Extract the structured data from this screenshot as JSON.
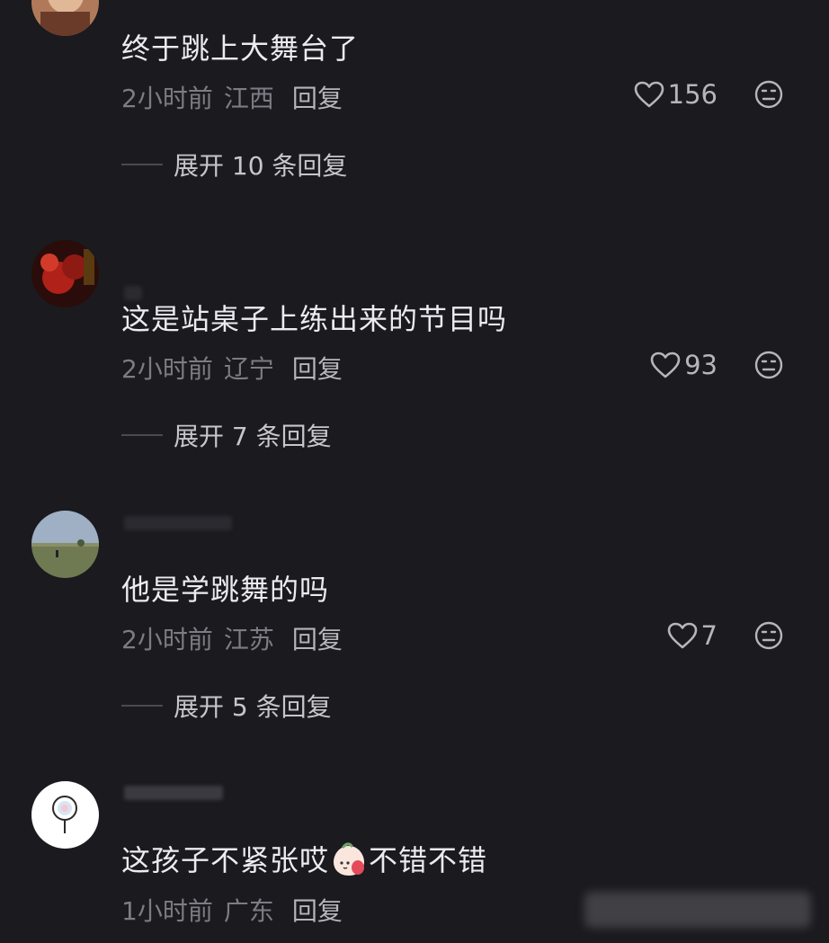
{
  "comments": [
    {
      "text": "终于跳上大舞台了",
      "time": "2小时前",
      "location": "江西",
      "reply_label": "回复",
      "likes": "156",
      "expand": "展开 10 条回复"
    },
    {
      "text": "这是站桌子上练出来的节目吗",
      "time": "2小时前",
      "location": "辽宁",
      "reply_label": "回复",
      "likes": "93",
      "expand": "展开 7 条回复"
    },
    {
      "text": "他是学跳舞的吗",
      "time": "2小时前",
      "location": "江苏",
      "reply_label": "回复",
      "likes": "7",
      "expand": "展开 5 条回复"
    },
    {
      "text_before_emoji": "这孩子不紧张哎",
      "text_after_emoji": "不错不错",
      "emoji": "peach-face-emoji",
      "time": "1小时前",
      "location": "广东",
      "reply_label": "回复"
    }
  ],
  "icons": {
    "like": "heart-outline-icon",
    "dislike": "neutral-face-icon"
  },
  "colors": {
    "background": "#1a1a1f",
    "text": "#ecebf0",
    "meta": "#7d7c84",
    "muted": "#b6b5bc"
  }
}
